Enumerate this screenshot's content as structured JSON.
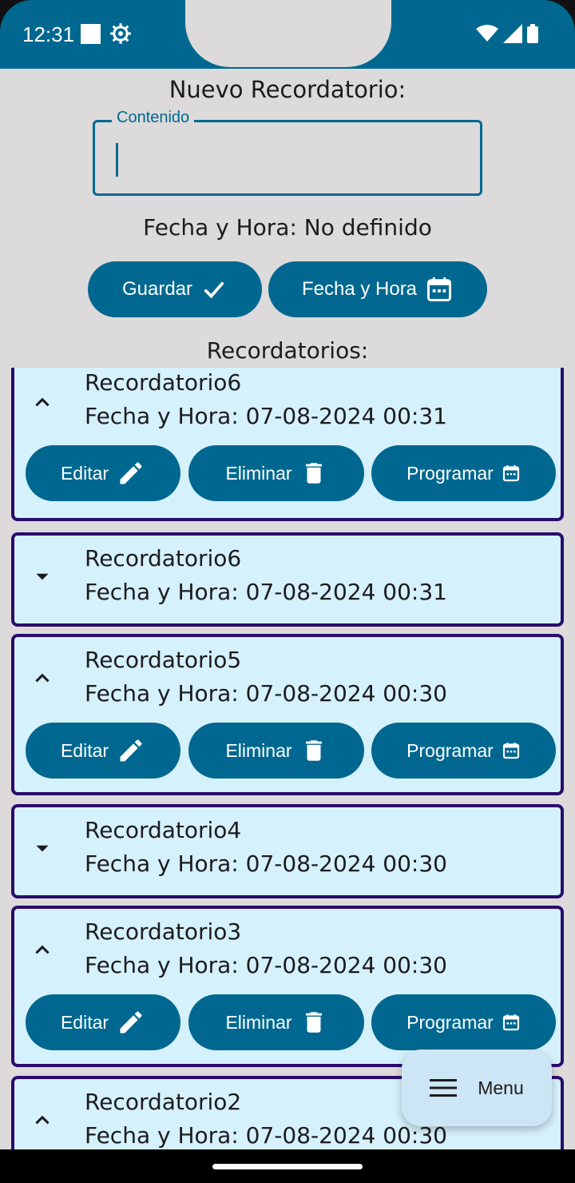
{
  "status_bar": {
    "time": "12:31"
  },
  "form": {
    "title": "Nuevo Recordatorio:",
    "content_label": "Contenido",
    "content_value": "",
    "date_status": "Fecha y Hora: No definido",
    "save_label": "Guardar",
    "datetime_label": "Fecha y Hora"
  },
  "list_title": "Recordatorios:",
  "reminders": [
    {
      "name": "Recordatorio6",
      "date": "Fecha y Hora: 07-08-2024 00:31",
      "expanded": true
    },
    {
      "name": "Recordatorio6",
      "date": "Fecha y Hora: 07-08-2024 00:31",
      "expanded": false
    },
    {
      "name": "Recordatorio5",
      "date": "Fecha y Hora: 07-08-2024 00:30",
      "expanded": true
    },
    {
      "name": "Recordatorio4",
      "date": "Fecha y Hora: 07-08-2024 00:30",
      "expanded": false
    },
    {
      "name": "Recordatorio3",
      "date": "Fecha y Hora: 07-08-2024 00:30",
      "expanded": true
    },
    {
      "name": "Recordatorio2",
      "date": "Fecha y Hora: 07-08-2024 00:30",
      "expanded": true
    }
  ],
  "actions": {
    "edit": "Editar",
    "delete": "Eliminar",
    "schedule": "Programar"
  },
  "fab": {
    "label": "Menu"
  },
  "colors": {
    "primary": "#006890",
    "card_bg": "#d5f1fb",
    "card_border": "#2a0c6b",
    "background": "#dcdada",
    "fab_bg": "#cde6f6"
  }
}
